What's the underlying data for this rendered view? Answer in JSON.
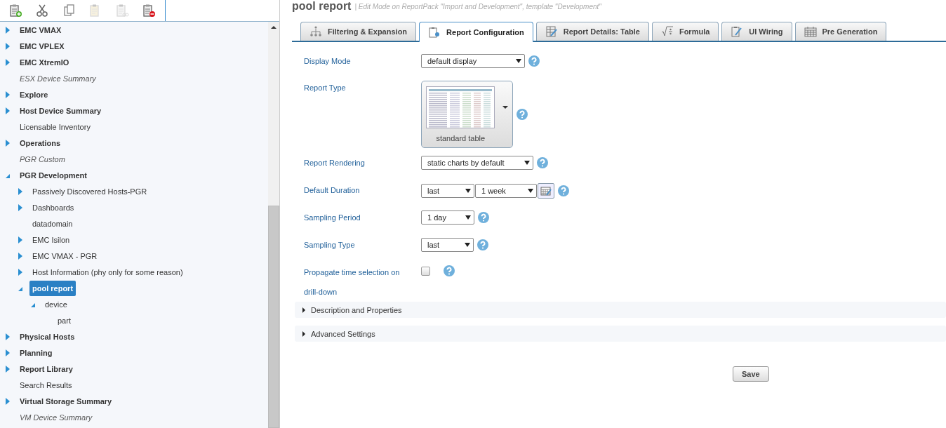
{
  "toolbar": [
    {
      "kind": "new",
      "disabled": false
    },
    {
      "kind": "cut",
      "disabled": false
    },
    {
      "kind": "copy",
      "disabled": false
    },
    {
      "kind": "paste",
      "disabled": true
    },
    {
      "kind": "link",
      "disabled": true
    },
    {
      "kind": "delete",
      "disabled": false
    }
  ],
  "tree": [
    {
      "label": "EMC VMAX",
      "kind": "folder",
      "expanded": false,
      "selected": false
    },
    {
      "label": "EMC VPLEX",
      "kind": "folder",
      "expanded": false,
      "selected": false
    },
    {
      "label": "EMC XtremIO",
      "kind": "folder",
      "expanded": false,
      "selected": false
    },
    {
      "label": "ESX Device Summary",
      "kind": "template",
      "selected": false
    },
    {
      "label": "Explore",
      "kind": "folder",
      "expanded": false,
      "selected": false
    },
    {
      "label": "Host Device Summary",
      "kind": "folder",
      "expanded": false,
      "selected": false
    },
    {
      "label": "Licensable Inventory",
      "kind": "report",
      "selected": false
    },
    {
      "label": "Operations",
      "kind": "folder",
      "expanded": false,
      "selected": false
    },
    {
      "label": "PGR Custom",
      "kind": "template",
      "selected": false
    },
    {
      "label": "PGR Development",
      "kind": "folder",
      "expanded": true,
      "selected": false,
      "children": [
        {
          "label": "Passively Discovered Hosts-PGR",
          "kind": "node",
          "expanded": false,
          "selected": false
        },
        {
          "label": "Dashboards",
          "kind": "node",
          "expanded": false,
          "selected": false
        },
        {
          "label": "datadomain",
          "kind": "leaf",
          "selected": false
        },
        {
          "label": "EMC Isilon",
          "kind": "node",
          "expanded": false,
          "selected": false
        },
        {
          "label": "EMC VMAX - PGR",
          "kind": "node",
          "expanded": false,
          "selected": false
        },
        {
          "label": "Host Information (phy only for some reason)",
          "kind": "node",
          "expanded": false,
          "selected": false
        },
        {
          "label": "pool report",
          "kind": "node",
          "expanded": true,
          "selected": true,
          "children": [
            {
              "label": "device",
              "kind": "node",
              "expanded": true,
              "selected": false,
              "children": [
                {
                  "label": "part",
                  "kind": "leaf",
                  "selected": false
                }
              ]
            }
          ]
        }
      ]
    },
    {
      "label": "Physical Hosts",
      "kind": "folder",
      "expanded": false,
      "selected": false
    },
    {
      "label": "Planning",
      "kind": "folder",
      "expanded": false,
      "selected": false
    },
    {
      "label": "Report Library",
      "kind": "folder",
      "expanded": false,
      "selected": false
    },
    {
      "label": "Search Results",
      "kind": "report",
      "selected": false
    },
    {
      "label": "Virtual Storage Summary",
      "kind": "folder",
      "expanded": false,
      "selected": false
    },
    {
      "label": "VM Device Summary",
      "kind": "template",
      "selected": false
    }
  ],
  "header": {
    "title": "pool report",
    "subtitle": "| Edit Mode on ReportPack \"Import and Development\", template \"Development\""
  },
  "tabs": [
    {
      "label": "Filtering & Expansion",
      "selected": false
    },
    {
      "label": "Report Configuration",
      "selected": true
    },
    {
      "label": "Report Details: Table",
      "selected": false
    },
    {
      "label": "Formula",
      "selected": false
    },
    {
      "label": "UI Wiring",
      "selected": false
    },
    {
      "label": "Pre Generation",
      "selected": false
    }
  ],
  "form": [
    {
      "kind": "select",
      "label": "Display Mode",
      "selects": [
        "default display"
      ]
    },
    {
      "kind": "picker",
      "label": "Report Type",
      "value": "standard table"
    },
    {
      "kind": "select",
      "label": "Report Rendering",
      "selects": [
        "static charts by default"
      ]
    },
    {
      "kind": "duration",
      "label": "Default Duration",
      "selects": [
        "last",
        "1 week"
      ]
    },
    {
      "kind": "select",
      "label": "Sampling Period",
      "selects": [
        "1 day"
      ]
    },
    {
      "kind": "select",
      "label": "Sampling Type",
      "selects": [
        "last"
      ]
    },
    {
      "kind": "checkbox",
      "label": "Propagate time selection on drill-down",
      "checked": false
    }
  ],
  "sections": [
    {
      "label": "Description and Properties",
      "expanded": false
    },
    {
      "label": "Advanced Settings",
      "expanded": false
    }
  ],
  "save": "Save"
}
